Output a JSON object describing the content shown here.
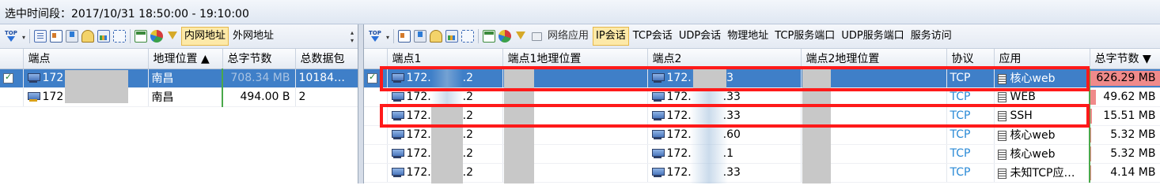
{
  "header": {
    "time_range": "选中时间段：2017/10/31  18:50:00 - 19:10:00"
  },
  "left_pane": {
    "toolbar": {
      "top_icon": "TOP",
      "tabs": [
        {
          "label": "内网地址",
          "active": true
        },
        {
          "label": "外网地址",
          "active": false
        }
      ]
    },
    "columns": [
      "端点",
      "地理位置 ▲",
      "总字节数",
      "总数据包"
    ],
    "rows": [
      {
        "endpoint": "172",
        "geo": "南昌",
        "bytes": "708.34 MB",
        "packets": "10184…",
        "selected": true,
        "checked": true,
        "icon": "host-icon"
      },
      {
        "endpoint": "172",
        "geo": "南昌",
        "bytes": "494.00 B",
        "packets": "2",
        "selected": false,
        "checked": false,
        "icon": "host-warn-icon"
      }
    ]
  },
  "right_pane": {
    "toolbar": {
      "top_icon": "TOP",
      "tabs": [
        {
          "label": "网络应用",
          "active": false
        },
        {
          "label": "IP会话",
          "active": true
        },
        {
          "label": "TCP会话",
          "active": false
        },
        {
          "label": "UDP会话",
          "active": false
        },
        {
          "label": "物理地址",
          "active": false
        },
        {
          "label": "TCP服务端口",
          "active": false
        },
        {
          "label": "UDP服务端口",
          "active": false
        },
        {
          "label": "服务访问",
          "active": false
        }
      ]
    },
    "columns": [
      "端点1",
      "端点1地理位置",
      "端点2",
      "端点2地理位置",
      "协议",
      "应用",
      "总字节数 ▼"
    ],
    "rows": [
      {
        "ep1": "172.",
        "ep1_tail": ".2",
        "ep2": "172.",
        "ep2_tail": ".3",
        "protocol": "TCP",
        "app": "核心web",
        "bytes": "626.29 MB",
        "bytes_fraction": 1.0,
        "selected": true,
        "checked": true
      },
      {
        "ep1": "172.",
        "ep1_tail": ".2",
        "ep2": "172.",
        "ep2_tail": ".33",
        "protocol": "TCP",
        "app": "WEB",
        "bytes": "49.62 MB",
        "bytes_fraction": 0.08,
        "selected": false,
        "checked": false
      },
      {
        "ep1": "172.",
        "ep1_tail": ".2",
        "ep2": "172.",
        "ep2_tail": ".33",
        "protocol": "TCP",
        "app": "SSH",
        "bytes": "15.51 MB",
        "bytes_fraction": 0.02,
        "selected": false,
        "checked": false
      },
      {
        "ep1": "172.",
        "ep1_tail": ".2",
        "ep2": "172.",
        "ep2_tail": ".60",
        "protocol": "TCP",
        "app": "核心web",
        "bytes": "5.32 MB",
        "bytes_fraction": 0.01,
        "selected": false,
        "checked": false
      },
      {
        "ep1": "172.",
        "ep1_tail": ".2",
        "ep2": "172.",
        "ep2_tail": ".1",
        "protocol": "TCP",
        "app": "核心web",
        "bytes": "5.32 MB",
        "bytes_fraction": 0.01,
        "selected": false,
        "checked": false
      },
      {
        "ep1": "172.",
        "ep1_tail": ".2",
        "ep2": "172.",
        "ep2_tail": ".33",
        "protocol": "TCP",
        "app": "未知TCP应…",
        "bytes": "4.14 MB",
        "bytes_fraction": 0.01,
        "selected": false,
        "checked": false
      }
    ]
  },
  "colors": {
    "selection": "#3f7fc8",
    "highlight_box": "#ff1a1a",
    "protocol_text": "#2a8ad6",
    "bytes_bar": "#f08a8a"
  }
}
